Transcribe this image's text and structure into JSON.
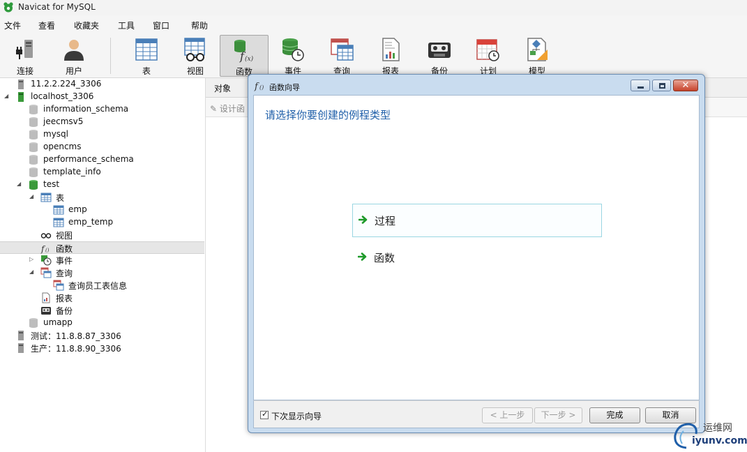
{
  "window": {
    "title": "Navicat for MySQL"
  },
  "menu": [
    "文件",
    "查看",
    "收藏夹",
    "工具",
    "窗口",
    "帮助"
  ],
  "toolbar": {
    "connect": "连接",
    "user": "用户",
    "table": "表",
    "view": "视图",
    "function": "函数",
    "event": "事件",
    "query": "查询",
    "report": "报表",
    "backup": "备份",
    "schedule": "计划",
    "model": "模型",
    "active": "函数"
  },
  "tree": {
    "conn1": "11.2.2.224_3306",
    "localhost": "localhost_3306",
    "db_information_schema": "information_schema",
    "db_jeecmsv5": "jeecmsv5",
    "db_mysql": "mysql",
    "db_opencms": "opencms",
    "db_performance_schema": "performance_schema",
    "db_template_info": "template_info",
    "db_test": "test",
    "tables": "表",
    "table_emp": "emp",
    "table_emp_temp": "emp_temp",
    "views": "视图",
    "functions": "函数",
    "events": "事件",
    "queries": "查询",
    "query_item": "查询员工表信息",
    "reports": "报表",
    "backups": "备份",
    "db_umapp": "umapp",
    "conn_test": "测试：11.8.8.87_3306",
    "conn_prod": "生产：11.8.8.90_3306"
  },
  "main": {
    "tab_objects": "对象",
    "design_function": "设计函"
  },
  "dialog": {
    "title": "函数向导",
    "heading": "请选择你要创建的例程类型",
    "option_procedure": "过程",
    "option_function": "函数",
    "show_wizard_label": "下次显示向导",
    "show_wizard_checked": true,
    "btn_prev": "< 上一步",
    "btn_next": "下一步 >",
    "btn_finish": "完成",
    "btn_cancel": "取消"
  },
  "watermark": {
    "line1": "运维网",
    "line2": "iyunv.com"
  },
  "colors": {
    "accent_blue": "#1f5fa9",
    "dialog_frame": "#c9dcef",
    "selection_border": "#9ad6e2",
    "db_green": "#3aa53a"
  }
}
